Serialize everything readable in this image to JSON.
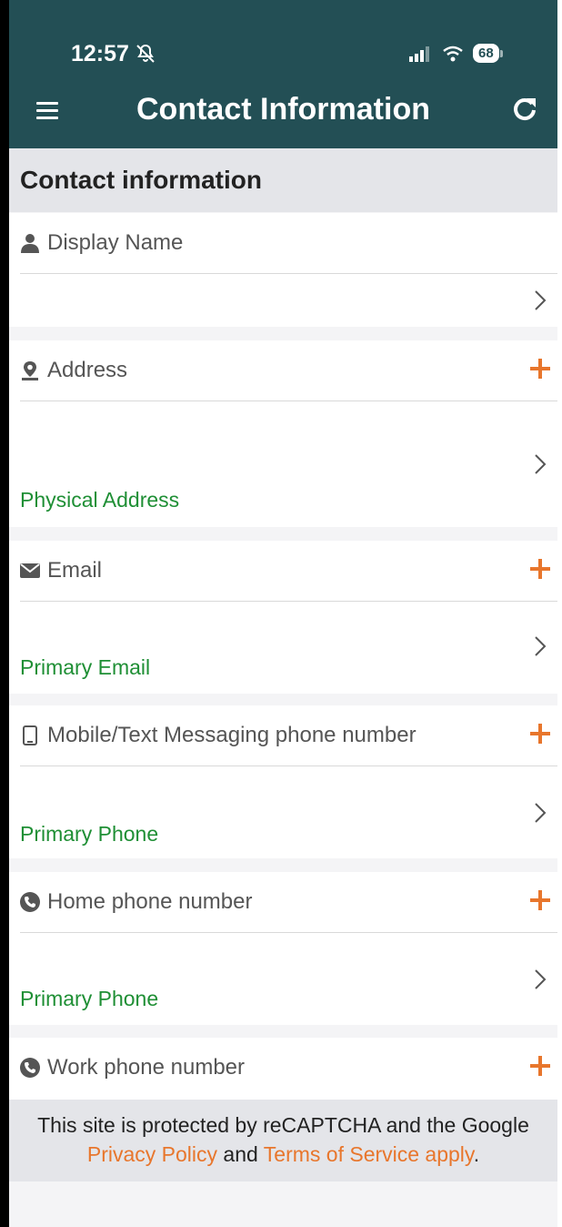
{
  "status_bar": {
    "time": "12:57",
    "battery": "68"
  },
  "header": {
    "title": "Contact Information"
  },
  "section": {
    "title": "Contact information"
  },
  "cards": {
    "display_name": {
      "label": "Display Name"
    },
    "address": {
      "label": "Address",
      "sub": "Physical Address"
    },
    "email": {
      "label": "Email",
      "sub": "Primary Email"
    },
    "mobile": {
      "label": "Mobile/Text Messaging phone number",
      "sub": "Primary Phone"
    },
    "home": {
      "label": "Home phone number",
      "sub": "Primary Phone"
    },
    "work": {
      "label": "Work phone number"
    }
  },
  "footer": {
    "line1": "This site is protected by reCAPTCHA and the Google",
    "privacy_link": "Privacy Policy",
    "and": "and",
    "terms_link": "Terms of Service apply",
    "period": "."
  },
  "colors": {
    "header_bg": "#234f55",
    "accent": "#e8762c",
    "sub_text": "#1f8f35"
  },
  "icons": [
    "bell-slash-icon",
    "signal-icon",
    "wifi-icon",
    "battery-icon",
    "hamburger-icon",
    "refresh-icon",
    "user-icon",
    "map-marker-icon",
    "envelope-icon",
    "mobile-icon",
    "phone-icon",
    "plus-icon",
    "chevron-right-icon"
  ]
}
